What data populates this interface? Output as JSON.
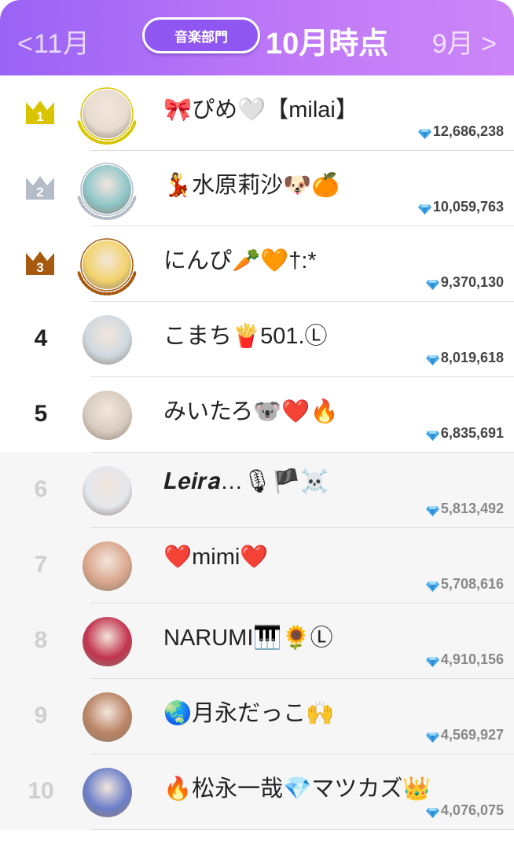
{
  "header": {
    "prev_label": "<11月",
    "category_label": "音楽部門",
    "period_label": "10月時点",
    "next_label": "9月 >"
  },
  "colors": {
    "header_gradient_start": "#9a63f5",
    "header_gradient_end": "#cc86f8",
    "gold": "#d9c400",
    "silver": "#b4bcc8",
    "bronze": "#a55a10",
    "gem": "#4aa8e8"
  },
  "ranking": [
    {
      "rank": "1",
      "name": "🎀ぴめ🤍【milai】",
      "points": "12,686,238",
      "avatar_color": "#e8dcd0"
    },
    {
      "rank": "2",
      "name": "💃水原莉沙🐶🍊",
      "points": "10,059,763",
      "avatar_color": "#8fc6c9"
    },
    {
      "rank": "3",
      "name": "にんぴ🥕🧡†:*",
      "points": "9,370,130",
      "avatar_color": "#f2d36b"
    },
    {
      "rank": "4",
      "name": "こまち🍟501.Ⓛ",
      "points": "8,019,618",
      "avatar_color": "#cfd9df"
    },
    {
      "rank": "5",
      "name": "みいたろ🐨❤️🔥",
      "points": "6,835,691",
      "avatar_color": "#d8ccc0"
    },
    {
      "rank": "6",
      "name": "𝑳𝒆𝒊𝒓𝒂…🎙🏴☠️",
      "points": "5,813,492",
      "avatar_color": "#e4e7ec"
    },
    {
      "rank": "7",
      "name": "❤️mimi❤️",
      "points": "5,708,616",
      "avatar_color": "#d9a68c"
    },
    {
      "rank": "8",
      "name": "NARUMI🎹🌻Ⓛ",
      "points": "4,910,156",
      "avatar_color": "#c2344f"
    },
    {
      "rank": "9",
      "name": "🌏月永だっこ🙌",
      "points": "4,569,927",
      "avatar_color": "#b98464"
    },
    {
      "rank": "10",
      "name": "🔥松永一哉💎マツカズ👑",
      "points": "4,076,075",
      "avatar_color": "#6c7fc9"
    }
  ]
}
